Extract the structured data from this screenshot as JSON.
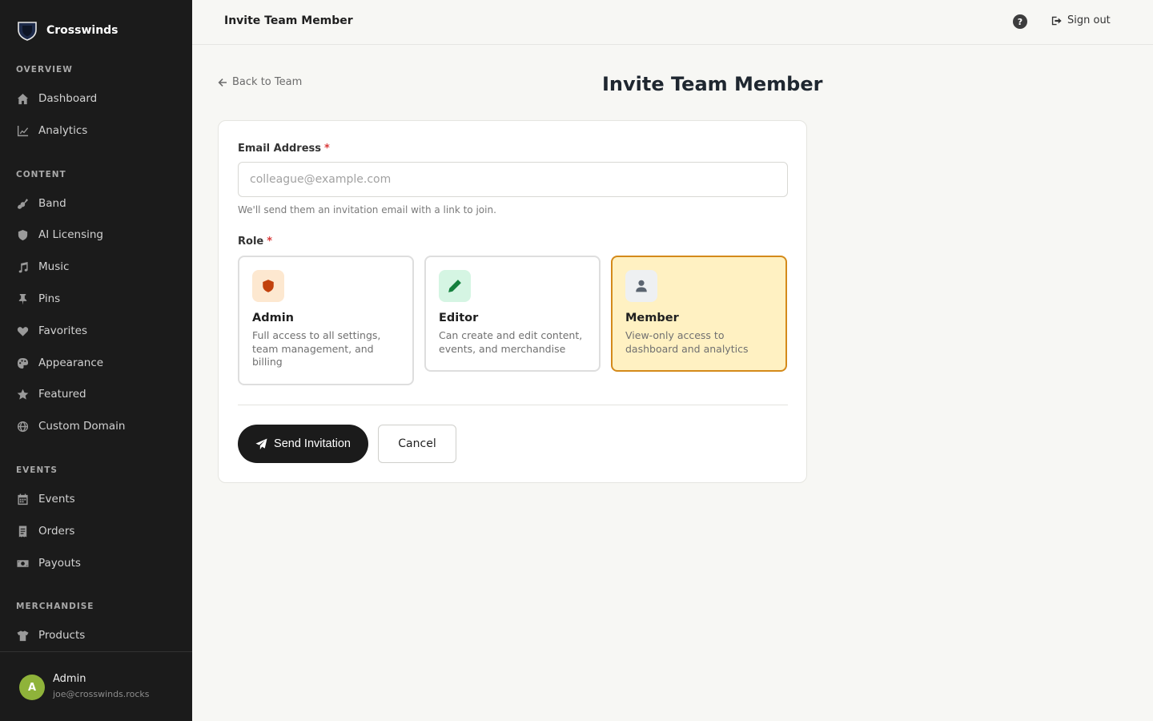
{
  "brand": {
    "name": "Crosswinds"
  },
  "sidebar": {
    "sections": [
      {
        "label": "OVERVIEW"
      },
      {
        "label": "CONTENT"
      },
      {
        "label": "EVENTS"
      },
      {
        "label": "MERCHANDISE"
      }
    ],
    "items": [
      {
        "label": "Dashboard",
        "icon": "home-icon"
      },
      {
        "label": "Analytics",
        "icon": "chart-line-icon"
      },
      {
        "label": "Band",
        "icon": "guitar-icon"
      },
      {
        "label": "AI Licensing",
        "icon": "shield-icon"
      },
      {
        "label": "Music",
        "icon": "music-note-icon"
      },
      {
        "label": "Pins",
        "icon": "pin-icon"
      },
      {
        "label": "Favorites",
        "icon": "heart-icon"
      },
      {
        "label": "Appearance",
        "icon": "palette-icon"
      },
      {
        "label": "Featured",
        "icon": "star-icon"
      },
      {
        "label": "Custom Domain",
        "icon": "globe-icon"
      },
      {
        "label": "Events",
        "icon": "calendar-icon"
      },
      {
        "label": "Orders",
        "icon": "receipt-icon"
      },
      {
        "label": "Payouts",
        "icon": "money-icon"
      },
      {
        "label": "Products",
        "icon": "shirt-icon"
      }
    ],
    "user": {
      "initial": "A",
      "name": "Admin",
      "email": "joe@crosswinds.rocks"
    }
  },
  "topbar": {
    "title": "Invite Team Member",
    "help": "?",
    "signout": "Sign out"
  },
  "page": {
    "back": "Back to Team",
    "title": "Invite Team Member"
  },
  "form": {
    "email_label": "Email Address",
    "required_mark": "*",
    "email_placeholder": "colleague@example.com",
    "email_value": "",
    "email_help": "We'll send them an invitation email with a link to join.",
    "role_label": "Role",
    "roles": [
      {
        "name": "Admin",
        "desc": "Full access to all settings, team management, and billing",
        "icon": "shield-icon",
        "color": "#c2410c",
        "bg": "#fde8d0",
        "selected": false
      },
      {
        "name": "Editor",
        "desc": "Can create and edit content, events, and merchandise",
        "icon": "pencil-icon",
        "color": "#15803d",
        "bg": "#d5f5e3",
        "selected": false
      },
      {
        "name": "Member",
        "desc": "View-only access to dashboard and analytics",
        "icon": "user-icon",
        "color": "#5b6470",
        "bg": "#eef0f2",
        "selected": true
      }
    ],
    "send_label": "Send Invitation",
    "cancel_label": "Cancel"
  },
  "colors": {
    "accent": "#d48a1a",
    "sidebar_bg": "#1b1b1b",
    "primary_button": "#1b1b1b"
  }
}
